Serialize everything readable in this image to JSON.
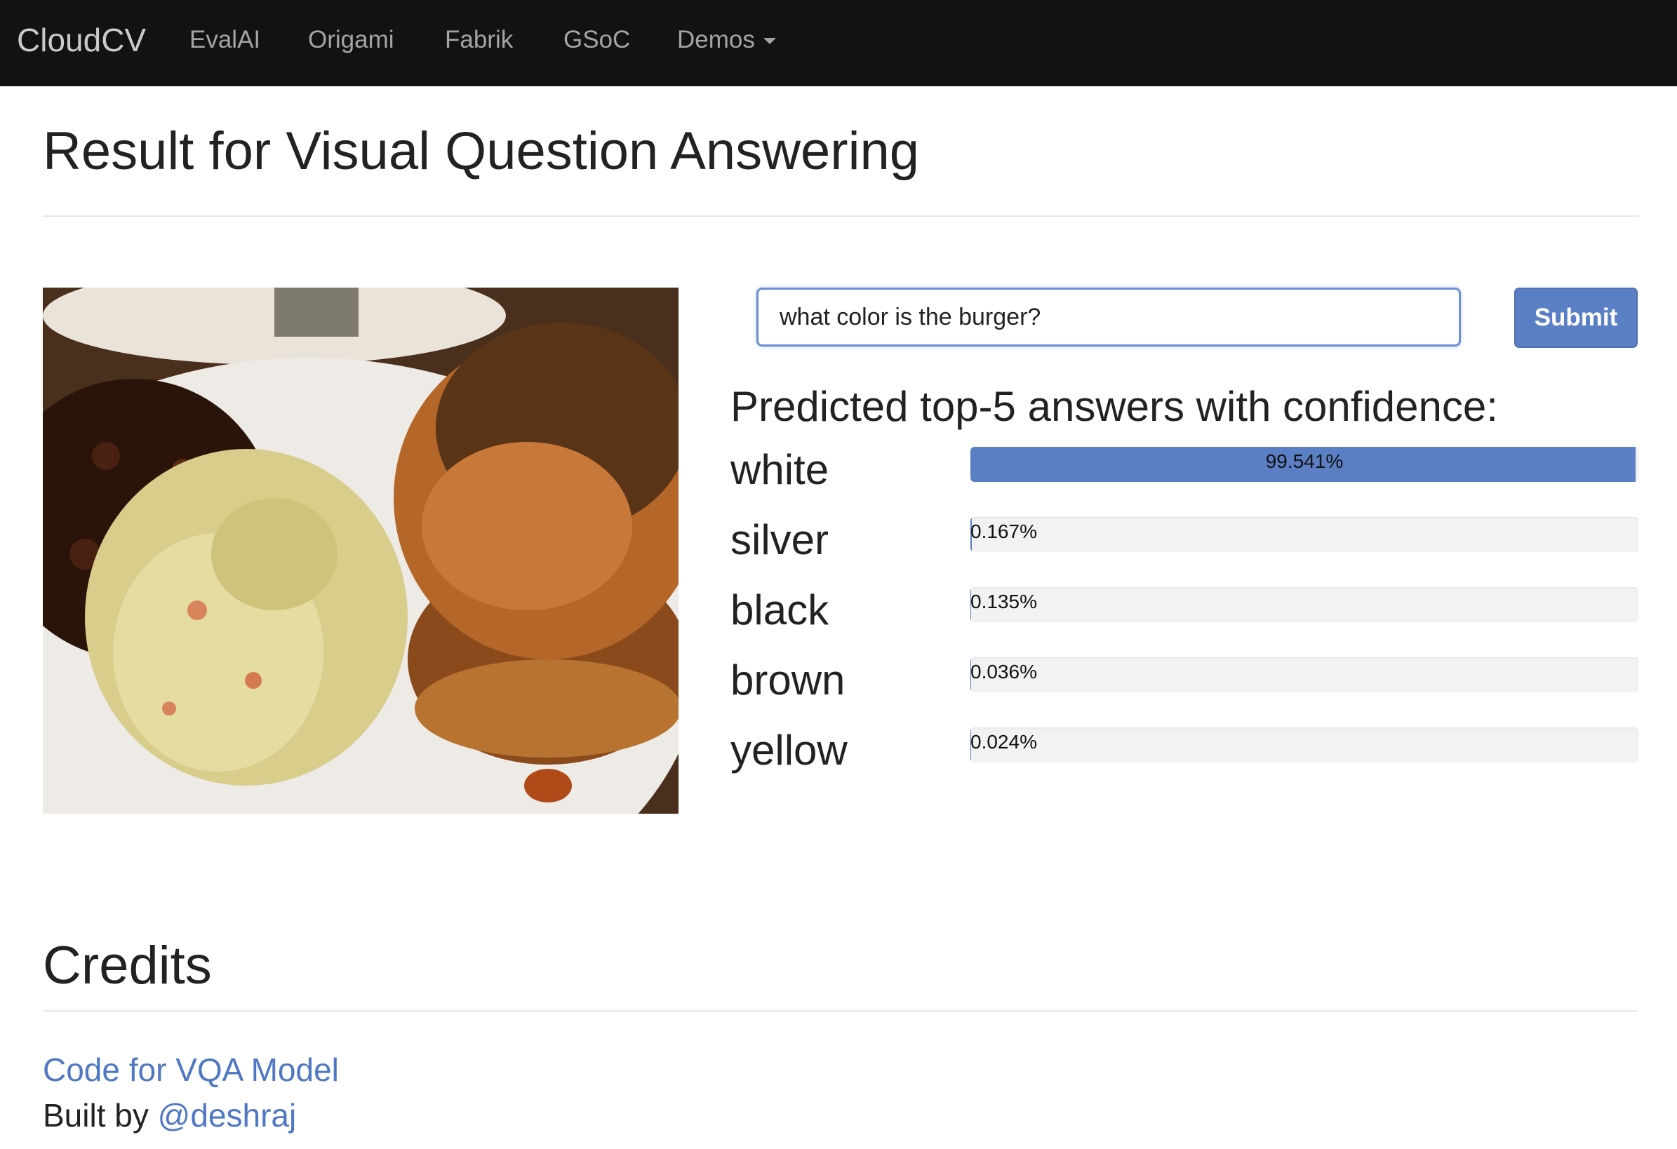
{
  "navbar": {
    "brand": "CloudCV",
    "items": [
      {
        "label": "EvalAI"
      },
      {
        "label": "Origami"
      },
      {
        "label": "Fabrik"
      },
      {
        "label": "GSoC"
      },
      {
        "label": "Demos",
        "icon": "caret-down-icon"
      }
    ]
  },
  "page_title": "Result for Visual Question Answering",
  "query": {
    "value": "what color is the burger?",
    "submit_label": "Submit"
  },
  "predictions": {
    "heading": "Predicted top-5 answers with confidence:",
    "items": [
      {
        "answer": "white",
        "confidence_label": "99.541%",
        "confidence": 99.541
      },
      {
        "answer": "silver",
        "confidence_label": "0.167%",
        "confidence": 0.167
      },
      {
        "answer": "black",
        "confidence_label": "0.135%",
        "confidence": 0.135
      },
      {
        "answer": "brown",
        "confidence_label": "0.036%",
        "confidence": 0.036
      },
      {
        "answer": "yellow",
        "confidence_label": "0.024%",
        "confidence": 0.024
      }
    ]
  },
  "credits": {
    "title": "Credits",
    "code_link": "Code for VQA Model",
    "built_by_prefix": "Built by",
    "built_by_handle": "@deshraj"
  },
  "colors": {
    "navbar_bg": "#121212",
    "accent": "#5b7fc4",
    "link": "#4f78c4"
  }
}
